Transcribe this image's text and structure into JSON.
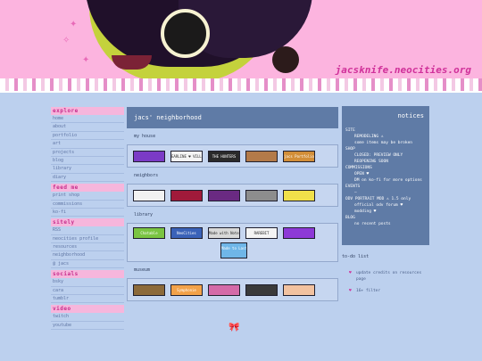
{
  "header": {
    "site_title": "jacsknife.neocities.org"
  },
  "sidebar": {
    "sections": [
      {
        "heading": "explore",
        "items": [
          "home",
          "about",
          "portfolio",
          "art",
          "projects",
          "blog",
          "library",
          "diary"
        ]
      },
      {
        "heading": "feed me",
        "items": [
          "print shop",
          "commissions",
          "ko-fi"
        ]
      },
      {
        "heading": "sitely",
        "items": [
          "RSS",
          "neocities profile",
          "resources",
          "neighborhood",
          "@ jacs"
        ]
      },
      {
        "heading": "socials",
        "items": [
          "bsky",
          "cara",
          "tumblr"
        ]
      },
      {
        "heading": "video",
        "items": [
          "twitch",
          "youtube"
        ]
      }
    ]
  },
  "main": {
    "title": "jacs' neighborhood",
    "sections": [
      {
        "label": "my house",
        "buttons": [
          {
            "text": "",
            "color": "#7b3bc6"
          },
          {
            "text": "EARLINE ♥ VILLANUEVA",
            "color": "#f4f4f4"
          },
          {
            "text": "THE HUNTERS",
            "color": "#2a2a2a"
          },
          {
            "text": "",
            "color": "#b37a49"
          },
          {
            "text": "jacs Portfolio",
            "color": "#d28e38"
          }
        ]
      },
      {
        "label": "neighbors",
        "buttons": [
          {
            "text": "",
            "color": "#f2f2f2"
          },
          {
            "text": "",
            "color": "#a01a3a"
          },
          {
            "text": "",
            "color": "#6a2a82"
          },
          {
            "text": "",
            "color": "#8d8d8d"
          },
          {
            "text": "",
            "color": "#f0e04a"
          }
        ]
      },
      {
        "label": "library",
        "buttons": [
          {
            "text": "Chatable",
            "color": "#7ac442"
          },
          {
            "text": "NeoCities",
            "color": "#3a62b8"
          },
          {
            "text": "Made with Notepad++",
            "color": "#d8d8d8"
          },
          {
            "text": "RAREBIT",
            "color": "#f4f4f4"
          },
          {
            "text": "",
            "color": "#8d39d6"
          }
        ],
        "extra": "Made to Last"
      },
      {
        "label": "museum",
        "buttons": [
          {
            "text": "",
            "color": "#8c6a3a"
          },
          {
            "text": "Symphonie",
            "color": "#f2a24a"
          },
          {
            "text": "",
            "color": "#d46aa8"
          },
          {
            "text": "",
            "color": "#3a3a3a"
          },
          {
            "text": "",
            "color": "#f2c2a0"
          }
        ]
      }
    ]
  },
  "notices": {
    "title": "notices",
    "lines": [
      {
        "text": "SITE",
        "indent": 0
      },
      {
        "text": "REMODELING ⚠",
        "indent": 1
      },
      {
        "text": "some items may be broken",
        "indent": 1
      },
      {
        "text": "SHOP",
        "indent": 0
      },
      {
        "text": "CLOSED: PREVIEW ONLY",
        "indent": 1
      },
      {
        "text": "REOPENING SOON",
        "indent": 1
      },
      {
        "text": "COMMISSIONS",
        "indent": 0
      },
      {
        "text": "OPEN ♥",
        "indent": 1
      },
      {
        "text": "DM on ko-fi for more options",
        "indent": 1
      },
      {
        "text": "EVENTS",
        "indent": 0
      },
      {
        "text": "—",
        "indent": 1
      },
      {
        "text": "ODV PORTRAIT MOD ⚠ 1.5 only",
        "indent": 0
      },
      {
        "text": "official odv forum ♥",
        "indent": 1
      },
      {
        "text": "modding ♥",
        "indent": 1
      },
      {
        "text": "BLOG",
        "indent": 0
      },
      {
        "text": "no recent posts",
        "indent": 1
      }
    ]
  },
  "todo": {
    "title": "to-do list",
    "items": [
      "update credits on resources page",
      "16+ filter"
    ]
  },
  "colors": {
    "background": "#bcd0ee",
    "header_pink": "#fcb4df",
    "panel_blue": "#5f7ba6",
    "accent_pink": "#d0319a"
  }
}
